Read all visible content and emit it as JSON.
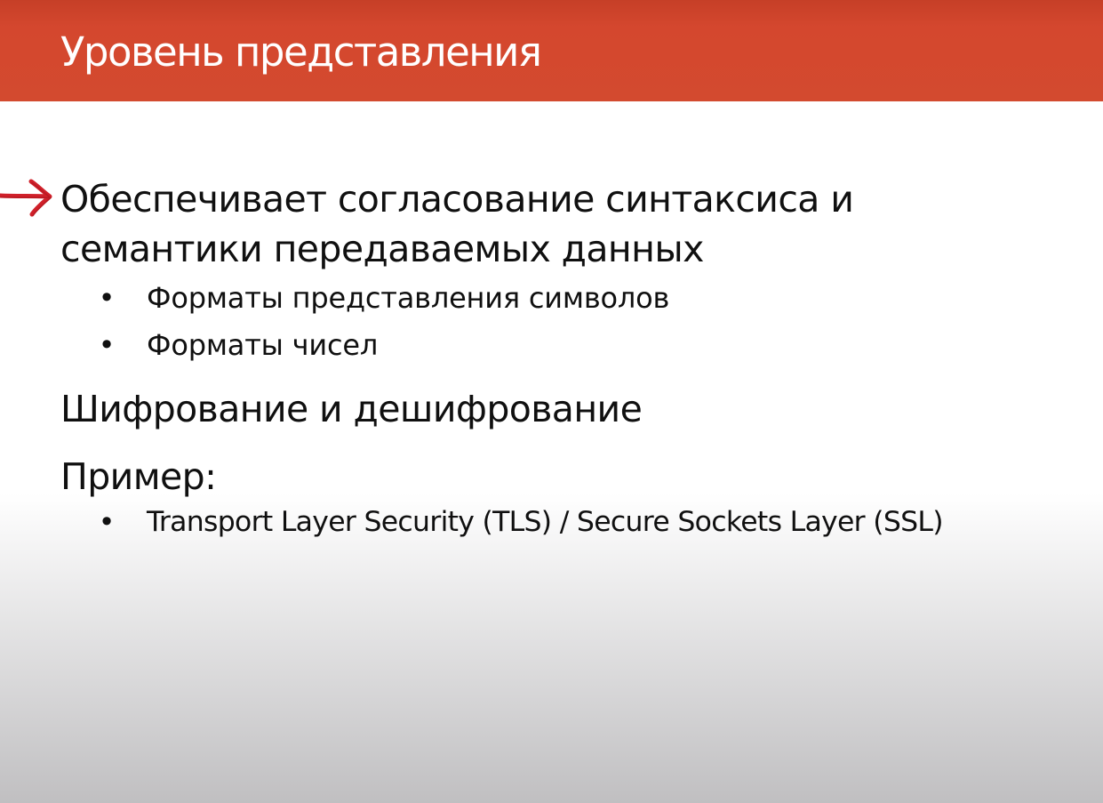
{
  "slide": {
    "title": "Уровень представления",
    "colors": {
      "title_bar": "#d34a2f",
      "title_text": "#ffffff",
      "body_text": "#101010",
      "pointer": "#d0202a"
    },
    "pointer_icon": "red-arrow-icon",
    "content": {
      "point1_line1": "Обеспечивает согласование синтаксиса и",
      "point1_line2": "семантики передаваемых данных",
      "point1_bullets": [
        "Форматы представления символов",
        "Форматы чисел"
      ],
      "point2": "Шифрование и дешифрование",
      "point3": "Пример:",
      "point3_bullets": [
        "Transport Layer Security (TLS) / Secure Sockets Layer (SSL)"
      ],
      "bullet_glyph": "•"
    }
  }
}
